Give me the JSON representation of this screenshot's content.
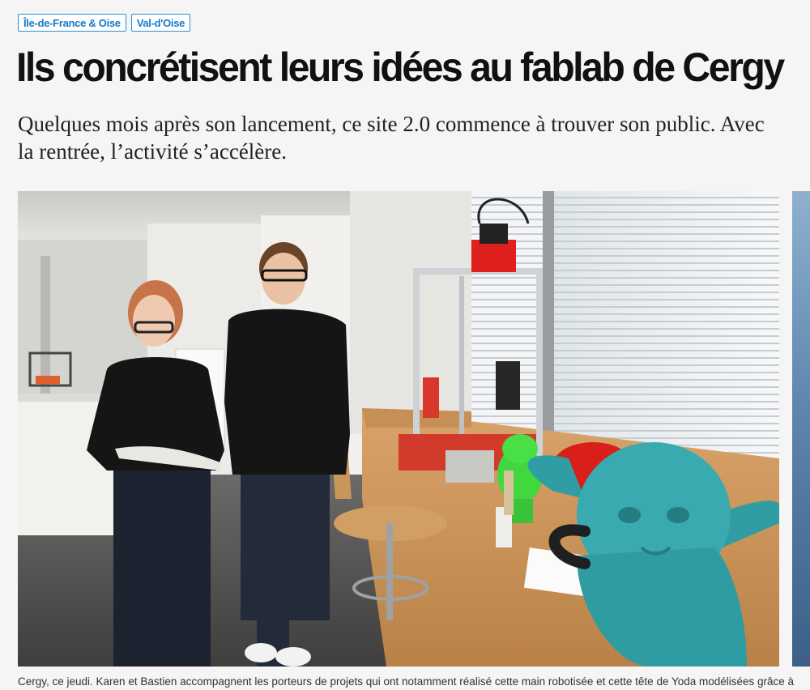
{
  "tags": [
    {
      "label": "Île-de-France & Oise"
    },
    {
      "label": "Val-d'Oise"
    }
  ],
  "article": {
    "title": "Ils concrétisent leurs idées au fablab de Cergy",
    "subtitle": "Quelques mois après son lancement, ce site 2.0 commence à trouver son public. Avec la rentrée, l’activité s’accélère.",
    "caption": "Cergy, ce jeudi. Karen et Bastien accompagnent les porteurs de projets qui ont notamment réalisé cette main robotisée et cette tête de Yoda modélisées grâce à la"
  },
  "colors": {
    "tag_accent": "#1479c9",
    "headline": "#111111",
    "background": "#f5f5f5"
  }
}
